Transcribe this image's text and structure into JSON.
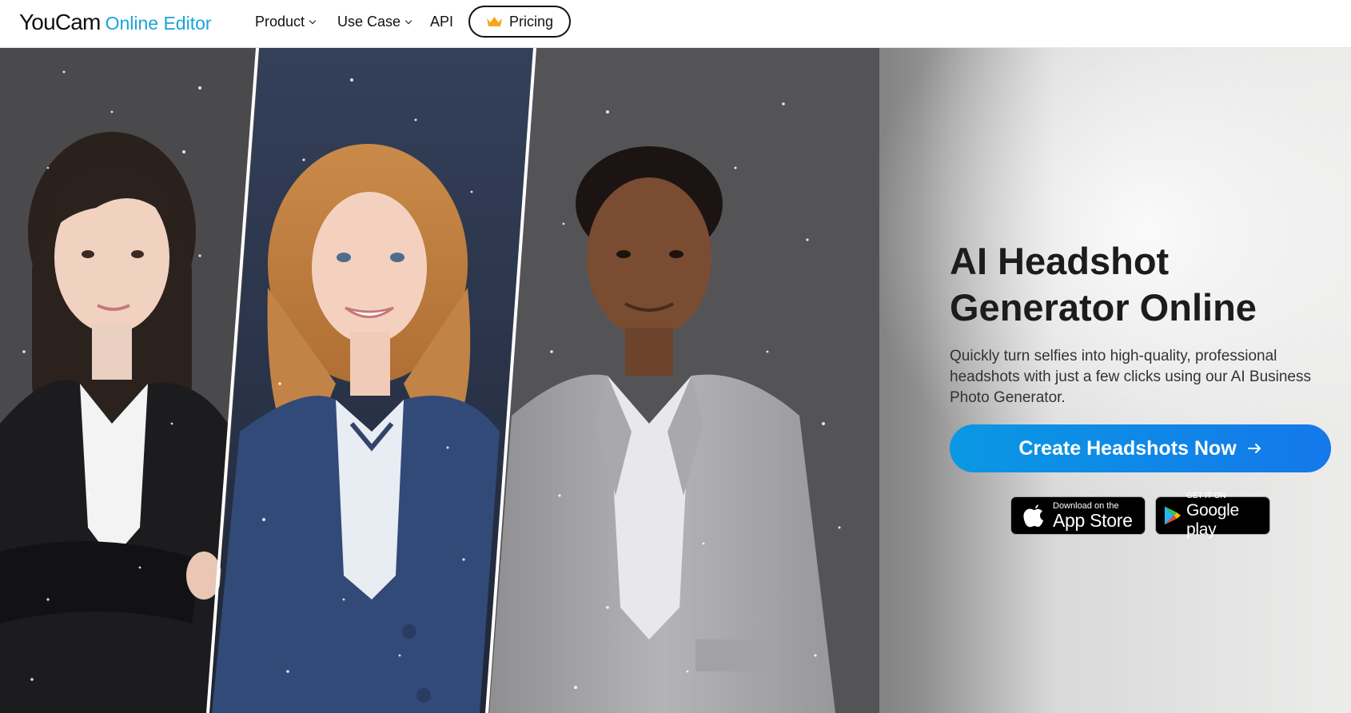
{
  "header": {
    "logo_main": "YouCam",
    "logo_sub": "Online Editor",
    "nav": [
      {
        "label": "Product",
        "has_dropdown": true
      },
      {
        "label": "Use Case",
        "has_dropdown": true
      },
      {
        "label": "API",
        "has_dropdown": false
      }
    ],
    "pricing_label": "Pricing",
    "pricing_icon": "crown-icon"
  },
  "hero": {
    "title_line1": "AI Headshot",
    "title_line2": "Generator Online",
    "description": "Quickly turn selfies into high-quality, professional headshots with just a few clicks using our AI Business Photo Generator.",
    "cta_label": "Create Headshots Now",
    "cta_icon": "arrow-right-icon",
    "app_store": {
      "small": "Download on the",
      "big": "App Store",
      "icon": "apple-icon"
    },
    "google_play": {
      "small": "GET IT ON",
      "big": "Google play",
      "icon": "google-play-icon"
    },
    "images": [
      "headshot-woman-black-blazer",
      "headshot-woman-navy-blazer",
      "headshot-man-gray-suit"
    ]
  },
  "colors": {
    "brand_blue": "#1aa4d8",
    "cta_start": "#0a98e4",
    "cta_end": "#1478ea",
    "crown": "#f2a81d",
    "text_dark": "#1c1c1c"
  }
}
